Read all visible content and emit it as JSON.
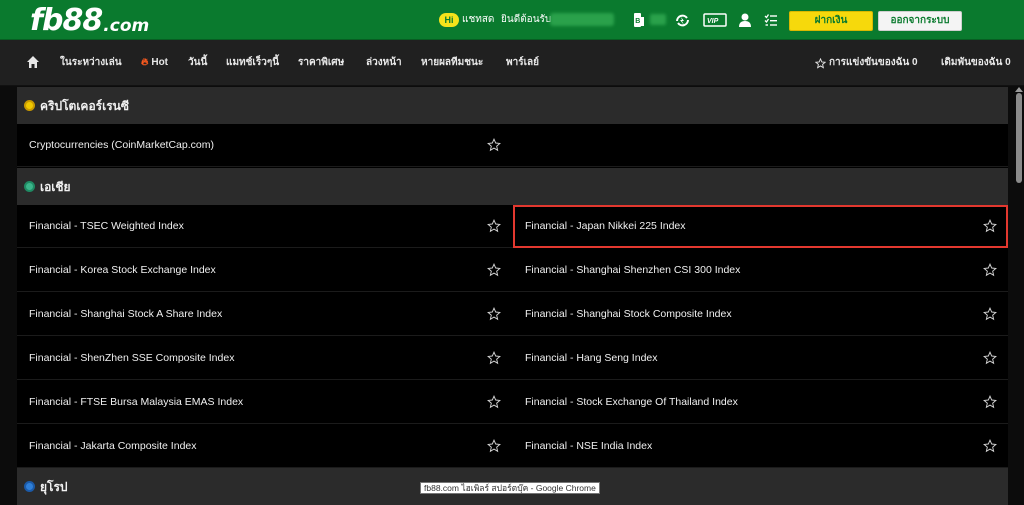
{
  "header": {
    "logo_main": "fb88",
    "logo_domain": ".com",
    "chat_badge": "Hi",
    "chat_label": "แชทสด",
    "welcome_label": "ยินดีต้อนรับ",
    "deposit_button": "ฝากเงิน",
    "logout_button": "ออกจากระบบ",
    "brand_color": "#0a7a2e",
    "deposit_color": "#f6d90c"
  },
  "nav": {
    "items": [
      {
        "label": "ในระหว่างเล่น"
      },
      {
        "label": "Hot"
      },
      {
        "label": "วันนี้"
      },
      {
        "label": "แมทช์เร็วๆนี้"
      },
      {
        "label": "ราคาพิเศษ"
      },
      {
        "label": "ล่วงหน้า"
      },
      {
        "label": "หายผลทีมชนะ"
      },
      {
        "label": "พาร์เลย์"
      }
    ],
    "my_competitions": "การแข่งขันของฉัน 0",
    "my_bets": "เดิมพันของฉัน 0"
  },
  "sections": [
    {
      "title": "คริปโตเคอร์เรนซี",
      "icon": "coin-icon",
      "icon_color": "#f0c800",
      "rows": [
        [
          "Cryptocurrencies (CoinMarketCap.com)",
          ""
        ]
      ]
    },
    {
      "title": "เอเชีย",
      "icon": "globe-asia-icon",
      "icon_color": "#3bb58a",
      "rows": [
        [
          "Financial - TSEC Weighted Index",
          "Financial - Japan Nikkei 225 Index"
        ],
        [
          "Financial - Korea Stock Exchange Index",
          "Financial - Shanghai Shenzhen CSI 300 Index"
        ],
        [
          "Financial - Shanghai Stock A Share Index",
          "Financial - Shanghai Stock Composite Index"
        ],
        [
          "Financial - ShenZhen SSE Composite Index",
          "Financial - Hang Seng Index"
        ],
        [
          "Financial - FTSE Bursa Malaysia EMAS Index",
          "Financial - Stock Exchange Of Thailand Index"
        ],
        [
          "Financial - Jakarta Composite Index",
          "Financial - NSE India Index"
        ]
      ]
    },
    {
      "title": "ยุโรป",
      "icon": "globe-europe-icon",
      "icon_color": "#2f7fd8",
      "rows": []
    }
  ],
  "highlight_color": "#e3382f",
  "tooltip": "fb88.com ไฮเพิลร์ สปอร์ตบุ๊ค - Google Chrome"
}
